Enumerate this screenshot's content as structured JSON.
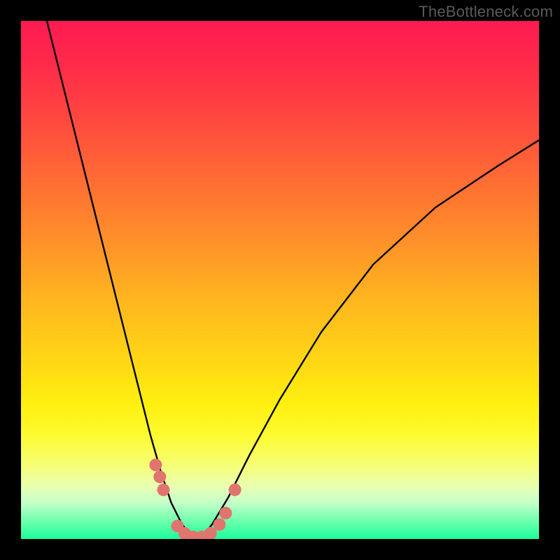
{
  "watermark": "TheBottleneck.com",
  "chart_data": {
    "type": "line",
    "title": "",
    "xlabel": "",
    "ylabel": "",
    "xlim": [
      0,
      100
    ],
    "ylim": [
      0,
      100
    ],
    "grid": false,
    "legend": false,
    "series": [
      {
        "name": "bottleneck-curve",
        "color": "#000000",
        "x": [
          5,
          8,
          11,
          14,
          17,
          20,
          23,
          25,
          27,
          29,
          31,
          32.5,
          34,
          35.5,
          37,
          40,
          44,
          50,
          58,
          68,
          80,
          92,
          100
        ],
        "y": [
          100,
          88,
          76,
          64,
          52,
          40,
          28,
          20,
          13,
          7,
          3,
          1,
          0.5,
          1,
          3,
          8,
          16,
          27,
          40,
          53,
          64,
          72,
          77
        ]
      }
    ],
    "markers": [
      {
        "name": "marker-cluster-left-upper",
        "color": "#e0746e",
        "x": 26.0,
        "y": 14.3
      },
      {
        "name": "marker-cluster-left-mid",
        "color": "#e0746e",
        "x": 26.8,
        "y": 12.0
      },
      {
        "name": "marker-cluster-left-low",
        "color": "#e0746e",
        "x": 27.5,
        "y": 9.5
      },
      {
        "name": "marker-trough-a",
        "color": "#e0746e",
        "x": 30.2,
        "y": 2.5
      },
      {
        "name": "marker-trough-b",
        "color": "#e0746e",
        "x": 31.6,
        "y": 1.1
      },
      {
        "name": "marker-trough-c",
        "color": "#e0746e",
        "x": 33.2,
        "y": 0.4
      },
      {
        "name": "marker-trough-d",
        "color": "#e0746e",
        "x": 34.9,
        "y": 0.4
      },
      {
        "name": "marker-trough-e",
        "color": "#e0746e",
        "x": 36.6,
        "y": 1.1
      },
      {
        "name": "marker-trough-f",
        "color": "#e0746e",
        "x": 38.3,
        "y": 2.8
      },
      {
        "name": "marker-trough-g",
        "color": "#e0746e",
        "x": 39.5,
        "y": 5.0
      },
      {
        "name": "marker-right-start",
        "color": "#e0746e",
        "x": 41.3,
        "y": 9.5
      }
    ],
    "gradient_stops": [
      {
        "pos": 0.0,
        "color": "#ff1a52"
      },
      {
        "pos": 0.5,
        "color": "#ffc41a"
      },
      {
        "pos": 0.8,
        "color": "#fbff2e"
      },
      {
        "pos": 1.0,
        "color": "#1aff9b"
      }
    ]
  }
}
